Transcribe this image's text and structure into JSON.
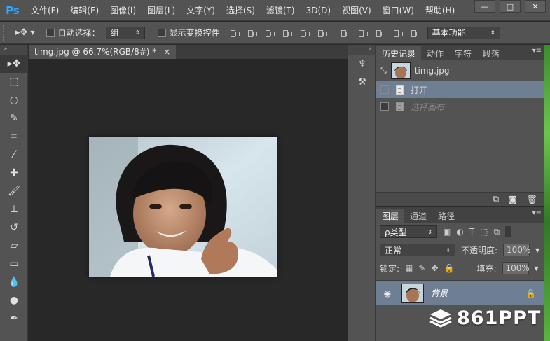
{
  "app": {
    "logo": "Ps",
    "menu": [
      "文件(F)",
      "编辑(E)",
      "图像(I)",
      "图层(L)",
      "文字(Y)",
      "选择(S)",
      "滤镜(T)",
      "3D(D)",
      "视图(V)",
      "窗口(W)",
      "帮助(H)"
    ],
    "window_controls": [
      "—",
      "□",
      "✕"
    ]
  },
  "options": {
    "auto_select_label": "自动选择：",
    "auto_select_value": "组",
    "show_transform_label": "显示变换控件",
    "workspace": "基本功能"
  },
  "document": {
    "tab_title": "timg.jpg @ 66.7%(RGB/8#) *",
    "close": "×"
  },
  "history": {
    "tabs": [
      "历史记录",
      "动作",
      "字符",
      "段落"
    ],
    "snapshot_name": "timg.jpg",
    "items": [
      "打开",
      "选择画布"
    ]
  },
  "layers": {
    "tabs": [
      "图层",
      "通道",
      "路径"
    ],
    "filter_type": "ρ类型",
    "blend_mode": "正常",
    "opacity_label": "不透明度:",
    "opacity_value": "100%",
    "lock_label": "锁定:",
    "fill_label": "填充:",
    "fill_value": "100%",
    "layer_name": "背景"
  },
  "watermark": {
    "text": "861PPT"
  },
  "colors": {
    "accent": "#31a8ff",
    "selection": "#6f7f93",
    "panel": "#535353"
  }
}
